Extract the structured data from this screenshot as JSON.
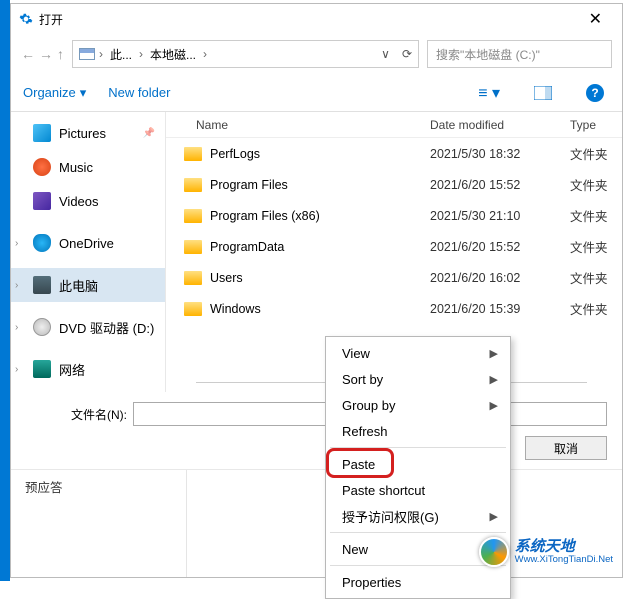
{
  "window": {
    "title": "打开",
    "close_icon": "close"
  },
  "breadcrumb": {
    "root": "此...",
    "current": "本地磁...",
    "dropdown_hint": "∨",
    "refresh": "⟳"
  },
  "search": {
    "placeholder": "搜索\"本地磁盘 (C:)\""
  },
  "toolbar": {
    "organize": "Organize",
    "new_folder": "New folder"
  },
  "sidebar": {
    "items": [
      {
        "label": "Pictures",
        "icon": "pictures-icon",
        "pinned": true
      },
      {
        "label": "Music",
        "icon": "music-icon"
      },
      {
        "label": "Videos",
        "icon": "videos-icon"
      },
      {
        "label": "OneDrive",
        "icon": "onedrive-icon",
        "expandable": true
      },
      {
        "label": "此电脑",
        "icon": "pc-icon",
        "selected": true,
        "expandable": true
      },
      {
        "label": "DVD 驱动器 (D:)",
        "icon": "dvd-icon",
        "expandable": true
      },
      {
        "label": "网络",
        "icon": "network-icon",
        "expandable": true
      }
    ]
  },
  "columns": {
    "name": "Name",
    "date": "Date modified",
    "type": "Type"
  },
  "files": [
    {
      "name": "PerfLogs",
      "date": "2021/5/30 18:32",
      "type": "文件夹"
    },
    {
      "name": "Program Files",
      "date": "2021/6/20 15:52",
      "type": "文件夹"
    },
    {
      "name": "Program Files (x86)",
      "date": "2021/5/30 21:10",
      "type": "文件夹"
    },
    {
      "name": "ProgramData",
      "date": "2021/6/20 15:52",
      "type": "文件夹"
    },
    {
      "name": "Users",
      "date": "2021/6/20 16:02",
      "type": "文件夹"
    },
    {
      "name": "Windows",
      "date": "2021/6/20 15:39",
      "type": "文件夹"
    }
  ],
  "filename": {
    "label": "文件名(N):"
  },
  "actions": {
    "cancel": "取消"
  },
  "context_menu": {
    "view": "View",
    "sort_by": "Sort by",
    "group_by": "Group by",
    "refresh": "Refresh",
    "paste": "Paste",
    "paste_shortcut": "Paste shortcut",
    "grant_access": "授予访问权限(G)",
    "new": "New",
    "properties": "Properties"
  },
  "bottom": {
    "label": "预应答"
  },
  "watermark": {
    "brand": "系统天地",
    "url": "Www.XiTongTianDi.Net"
  }
}
